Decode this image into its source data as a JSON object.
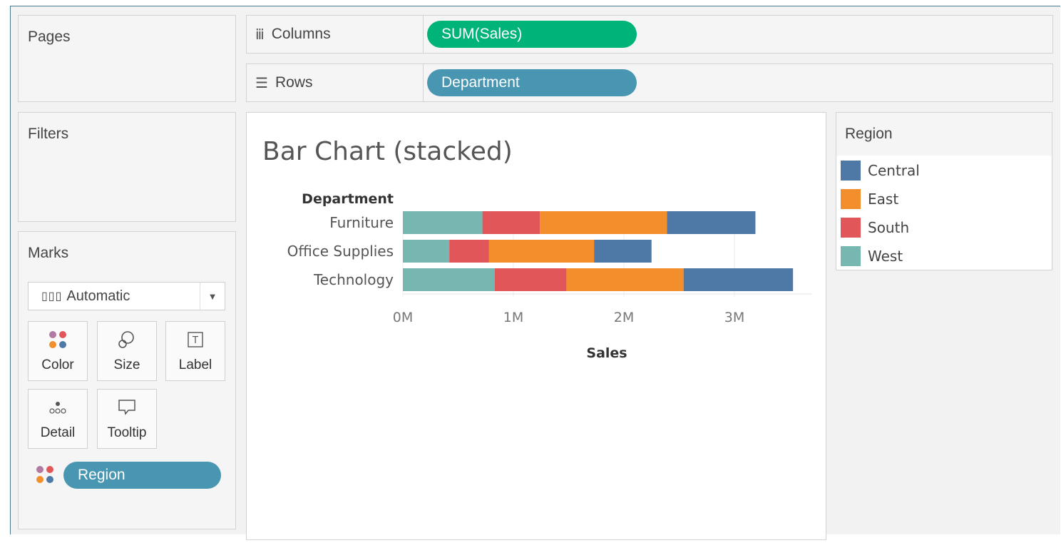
{
  "pages": {
    "title": "Pages"
  },
  "filters": {
    "title": "Filters"
  },
  "marks": {
    "title": "Marks",
    "mark_type": "Automatic",
    "buttons": {
      "color": "Color",
      "size": "Size",
      "label": "Label",
      "detail": "Detail",
      "tooltip": "Tooltip"
    },
    "color_field": "Region"
  },
  "shelves": {
    "columns": {
      "label": "Columns",
      "pill": "SUM(Sales)"
    },
    "rows": {
      "label": "Rows",
      "pill": "Department"
    }
  },
  "legend": {
    "title": "Region",
    "items": [
      {
        "label": "Central",
        "color": "#4e79a7"
      },
      {
        "label": "East",
        "color": "#f28e2b"
      },
      {
        "label": "South",
        "color": "#e15759"
      },
      {
        "label": "West",
        "color": "#76b7b2"
      }
    ]
  },
  "colors": {
    "green_pill": "#00b378",
    "blue_pill": "#4996b2"
  },
  "chart_data": {
    "type": "bar",
    "orientation": "horizontal",
    "stacked": true,
    "title": "Bar Chart (stacked)",
    "row_header": "Department",
    "categories": [
      "Furniture",
      "Office Supplies",
      "Technology"
    ],
    "series": [
      {
        "name": "West",
        "color": "#76b7b2",
        "values": [
          0.72,
          0.42,
          0.83
        ]
      },
      {
        "name": "South",
        "color": "#e15759",
        "values": [
          0.52,
          0.36,
          0.65
        ]
      },
      {
        "name": "East",
        "color": "#f28e2b",
        "values": [
          1.15,
          0.95,
          1.06
        ]
      },
      {
        "name": "Central",
        "color": "#4e79a7",
        "values": [
          0.8,
          0.52,
          0.99
        ]
      }
    ],
    "xlabel": "Sales",
    "xticks": [
      "0M",
      "1M",
      "2M",
      "3M"
    ],
    "xlim": [
      0,
      3.7
    ]
  }
}
